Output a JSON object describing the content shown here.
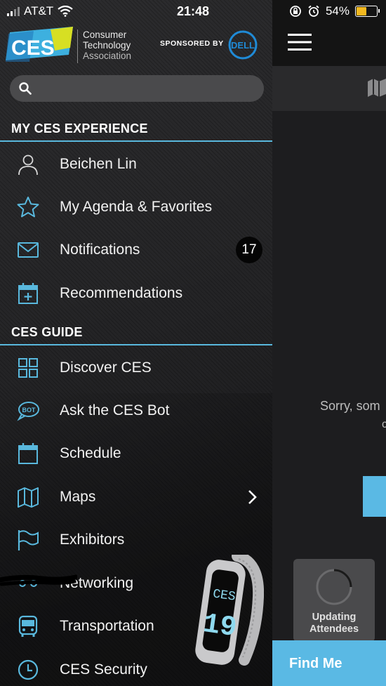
{
  "status_bar": {
    "carrier": "AT&T",
    "time": "21:48",
    "battery": "54%",
    "battery_level": 0.54,
    "battery_color": "#f3b81f"
  },
  "header": {
    "logo_text": "CES",
    "org_line1": "Consumer",
    "org_line2": "Technology",
    "org_line3": "Association",
    "sponsored_label": "SPONSORED BY",
    "sponsor_logo": "DELL"
  },
  "search": {
    "placeholder": ""
  },
  "sections": {
    "experience": {
      "title": "MY CES EXPERIENCE",
      "items": [
        {
          "label": "Beichen Lin",
          "icon": "user-icon"
        },
        {
          "label": "My Agenda & Favorites",
          "icon": "star-icon"
        },
        {
          "label": "Notifications",
          "icon": "envelope-icon",
          "badge": "17"
        },
        {
          "label": "Recommendations",
          "icon": "calendar-plus-icon"
        }
      ]
    },
    "guide": {
      "title": "CES GUIDE",
      "items": [
        {
          "label": "Discover CES",
          "icon": "grid-icon"
        },
        {
          "label": "Ask the CES Bot",
          "icon": "bot-icon"
        },
        {
          "label": "Schedule",
          "icon": "calendar-icon"
        },
        {
          "label": "Maps",
          "icon": "map-icon"
        },
        {
          "label": "Exhibitors",
          "icon": "flag-icon"
        },
        {
          "label": "Networking",
          "icon": "network-icon"
        },
        {
          "label": "Transportation",
          "icon": "bus-icon"
        },
        {
          "label": "CES Security",
          "icon": "clock-icon"
        }
      ]
    }
  },
  "main": {
    "sorry_text": "Sorry, som",
    "sorry_text_2": "c",
    "updating_line1": "Updating",
    "updating_line2": "Attendees",
    "find_me": "Find Me"
  },
  "colors": {
    "accent": "#59b8dd",
    "button_blue": "#5ab9e4",
    "badge_bg": "#050505"
  }
}
